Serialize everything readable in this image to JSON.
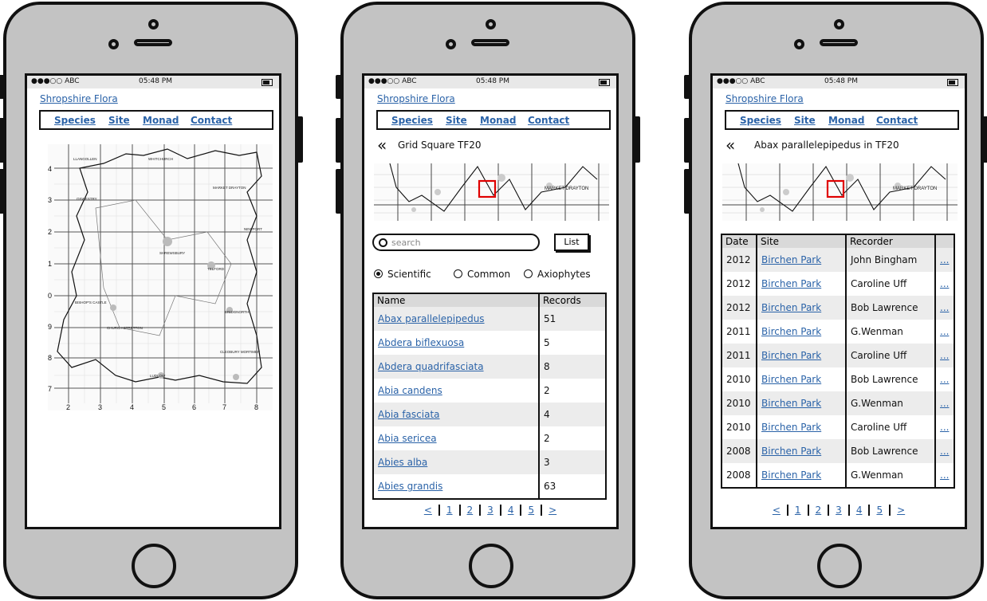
{
  "status": {
    "carrier": "●●●○○ ABC",
    "time": "05:48 PM"
  },
  "app_title": "Shropshire Flora",
  "nav": [
    "Species",
    "Site",
    "Monad",
    "Contact"
  ],
  "map1": {
    "y_ticks": [
      "4",
      "3",
      "2",
      "1",
      "0",
      "9",
      "8",
      "7"
    ],
    "x_ticks": [
      "2",
      "3",
      "4",
      "5",
      "6",
      "7",
      "8"
    ],
    "places": [
      "LLANGOLLEN",
      "WHITCHURCH",
      "MARKET DRAYTON",
      "OSWESTRY",
      "SHREWSBURY",
      "TELFORD",
      "NEWPORT",
      "BRIDGNORTH",
      "LUDLOW",
      "BISHOP'S CASTLE",
      "CHURCH STRETTON",
      "CLEOBURY MORTIMER"
    ]
  },
  "phone2": {
    "back_icon": "double-chevron-left-icon",
    "title": "Grid Square TF20",
    "map_label": "MARKET DRAYTON",
    "search_placeholder": "search",
    "list_button": "List",
    "filters": [
      "Scientific",
      "Common",
      "Axiophytes"
    ],
    "selected_filter": "Scientific",
    "table": {
      "headers": [
        "Name",
        "Records"
      ],
      "rows": [
        [
          "Abax parallelepipedus",
          "51"
        ],
        [
          "Abdera biflexuosa",
          "5"
        ],
        [
          "Abdera quadrifasciata",
          "8"
        ],
        [
          "Abia candens",
          "2"
        ],
        [
          "Abia fasciata",
          "4"
        ],
        [
          "Abia sericea",
          "2"
        ],
        [
          "Abies alba",
          "3"
        ],
        [
          "Abies grandis",
          "63"
        ]
      ]
    },
    "pager": [
      "<",
      "1",
      "2",
      "3",
      "4",
      "5",
      ">"
    ]
  },
  "phone3": {
    "back_icon": "double-chevron-left-icon",
    "title": "Abax parallelepipedus in TF20",
    "map_label": "MARKET DRAYTON",
    "table": {
      "headers": [
        "Date",
        "Site",
        "Recorder",
        ""
      ],
      "rows": [
        [
          "2012",
          "Birchen Park",
          "John Bingham",
          "..."
        ],
        [
          "2012",
          "Birchen Park",
          "Caroline Uff",
          "..."
        ],
        [
          "2012",
          "Birchen Park",
          "Bob Lawrence",
          "..."
        ],
        [
          "2011",
          "Birchen Park",
          "G.Wenman",
          "..."
        ],
        [
          "2011",
          "Birchen Park",
          "Caroline Uff",
          "..."
        ],
        [
          "2010",
          "Birchen Park",
          "Bob Lawrence",
          "..."
        ],
        [
          "2010",
          "Birchen Park",
          "G.Wenman",
          "..."
        ],
        [
          "2010",
          "Birchen Park",
          "Caroline Uff",
          "..."
        ],
        [
          "2008",
          "Birchen Park",
          "Bob Lawrence",
          "..."
        ],
        [
          "2008",
          "Birchen Park",
          "G.Wenman",
          "..."
        ]
      ]
    },
    "pager": [
      "<",
      "1",
      "2",
      "3",
      "4",
      "5",
      ">"
    ]
  },
  "colors": {
    "link": "#2b63a8",
    "phone_body": "#c3c3c3",
    "highlight": "#e00000",
    "row_alt": "#ececec"
  }
}
